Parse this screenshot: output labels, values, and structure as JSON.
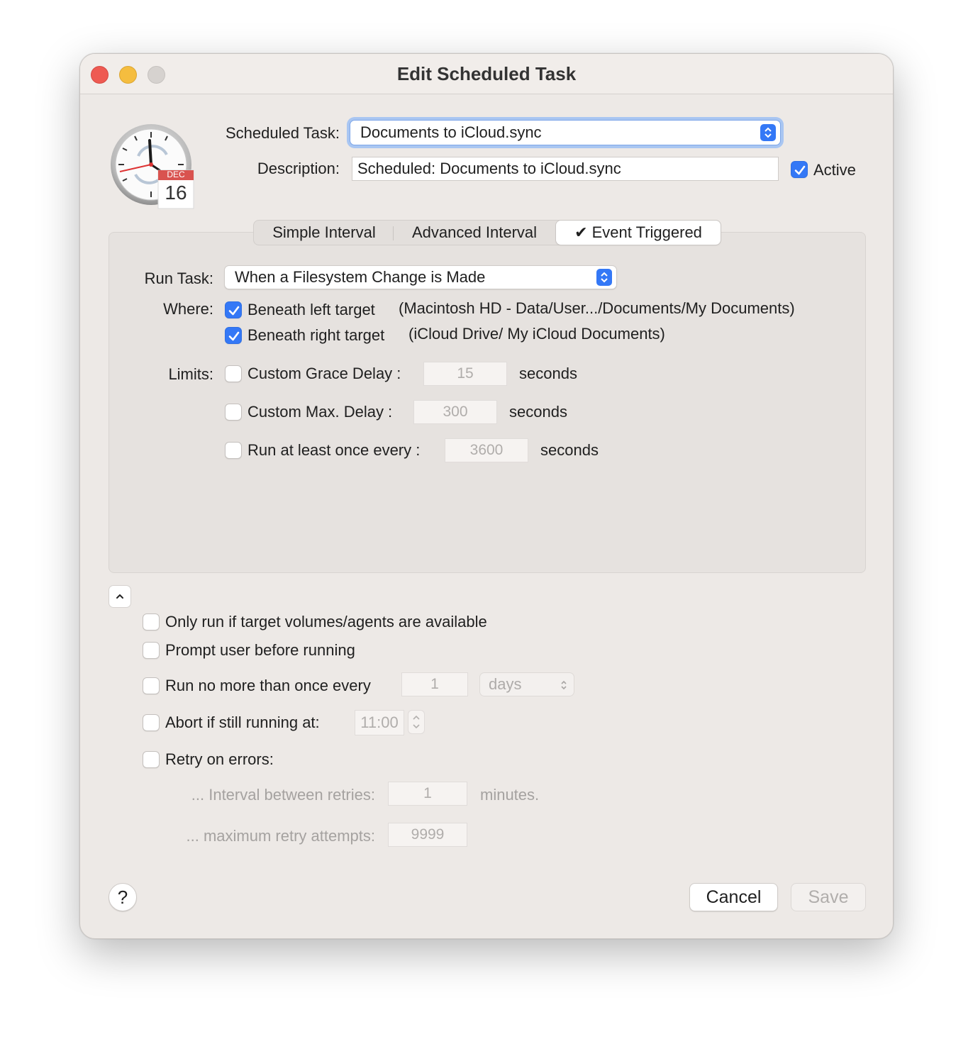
{
  "window": {
    "title": "Edit Scheduled Task"
  },
  "icon": {
    "month": "DEC",
    "day": "16"
  },
  "header": {
    "task_label": "Scheduled Task:",
    "task_value": "Documents to iCloud.sync",
    "description_label": "Description:",
    "description_value": "Scheduled: Documents to iCloud.sync",
    "active_label": "Active",
    "active_checked": true
  },
  "tabs": [
    {
      "label": "Simple Interval",
      "selected": false
    },
    {
      "label": "Advanced Interval",
      "selected": false
    },
    {
      "label": "✔ Event Triggered",
      "selected": true
    }
  ],
  "event": {
    "run_task_label": "Run Task:",
    "run_task_value": "When a Filesystem Change is Made",
    "where_label": "Where:",
    "left_target_label": "Beneath left target",
    "left_target_path": "(Macintosh HD - Data/User.../Documents/My Documents)",
    "right_target_label": "Beneath right target",
    "right_target_path": "(iCloud Drive/ My iCloud Documents)",
    "limits_label": "Limits:",
    "grace_label": "Custom Grace Delay :",
    "grace_value": "15",
    "max_label": "Custom Max. Delay :",
    "max_value": "300",
    "once_label": "Run at least once every :",
    "once_value": "3600",
    "seconds_label": "seconds"
  },
  "options": {
    "only_run_label": "Only run if target volumes/agents are available",
    "prompt_label": "Prompt user before running",
    "no_more_label": "Run no more than once every",
    "no_more_value": "1",
    "no_more_unit": "days",
    "abort_label": "Abort if still running at:",
    "abort_time": "11:00",
    "retry_label": "Retry on errors:",
    "interval_label": "... Interval between retries:",
    "interval_value": "1",
    "interval_unit": "minutes.",
    "max_retry_label": "... maximum retry attempts:",
    "max_retry_value": "9999"
  },
  "footer": {
    "help_label": "?",
    "cancel_label": "Cancel",
    "save_label": "Save"
  },
  "colors": {
    "accent": "#3478f6",
    "close": "#ee5a52",
    "minimize": "#f5bd3f",
    "window_bg": "#ede9e6"
  }
}
